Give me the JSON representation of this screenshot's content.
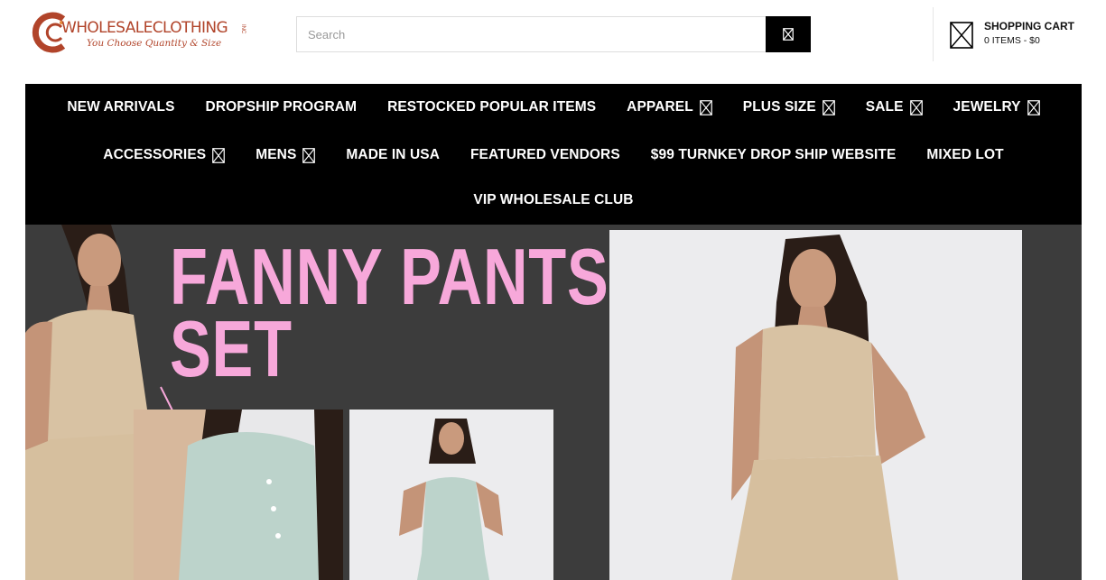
{
  "logo": {
    "brand": "WHOLESALECLOTHING",
    "suffix": "INC",
    "tagline": "You Choose Quantity & Size"
  },
  "search": {
    "placeholder": "Search",
    "button_icon": "search-icon"
  },
  "cart": {
    "title": "SHOPPING CART",
    "summary": "0 ITEMS - $0",
    "icon": "cart-icon"
  },
  "nav": {
    "row1": [
      {
        "label": "NEW ARRIVALS",
        "dropdown": false
      },
      {
        "label": "DROPSHIP PROGRAM",
        "dropdown": false
      },
      {
        "label": "RESTOCKED POPULAR ITEMS",
        "dropdown": false
      },
      {
        "label": "APPAREL",
        "dropdown": true
      },
      {
        "label": "PLUS SIZE",
        "dropdown": true
      },
      {
        "label": "SALE",
        "dropdown": true
      },
      {
        "label": "JEWELRY",
        "dropdown": true
      }
    ],
    "row2": [
      {
        "label": "ACCESSORIES",
        "dropdown": true
      },
      {
        "label": "MENS",
        "dropdown": true
      },
      {
        "label": "MADE IN USA",
        "dropdown": false
      },
      {
        "label": "FEATURED VENDORS",
        "dropdown": false
      },
      {
        "label": "$99 TURNKEY DROP SHIP WEBSITE",
        "dropdown": false
      },
      {
        "label": "MIXED LOT",
        "dropdown": false
      }
    ],
    "row3": [
      {
        "label": "VIP WHOLESALE CLUB",
        "dropdown": false
      }
    ]
  },
  "hero": {
    "title_line1": "FANNY PANTS",
    "title_line2": "SET"
  },
  "colors": {
    "brand": "#b1442a",
    "nav_bg": "#000000",
    "hero_bg": "#3c3c3c",
    "hero_title": "#f7a8da"
  }
}
